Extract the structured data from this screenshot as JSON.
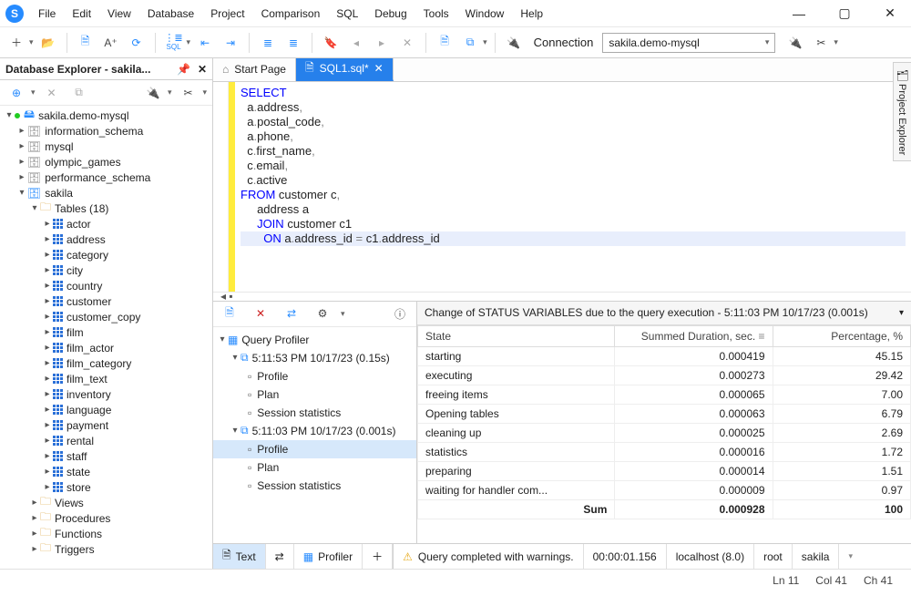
{
  "menubar": [
    "File",
    "Edit",
    "View",
    "Database",
    "Project",
    "Comparison",
    "SQL",
    "Debug",
    "Tools",
    "Window",
    "Help"
  ],
  "connection": {
    "label": "Connection",
    "value": "sakila.demo-mysql"
  },
  "sidebar": {
    "title": "Database Explorer - sakila...",
    "root": "sakila.demo-mysql",
    "schemas": [
      "information_schema",
      "mysql",
      "olympic_games",
      "performance_schema",
      "sakila"
    ],
    "tables_folder": "Tables (18)",
    "tables": [
      "actor",
      "address",
      "category",
      "city",
      "country",
      "customer",
      "customer_copy",
      "film",
      "film_actor",
      "film_category",
      "film_text",
      "inventory",
      "language",
      "payment",
      "rental",
      "staff",
      "state",
      "store"
    ],
    "folders": [
      "Views",
      "Procedures",
      "Functions",
      "Triggers"
    ]
  },
  "tabs": {
    "start": "Start Page",
    "sql": "SQL1.sql*"
  },
  "sql": {
    "l1": "SELECT",
    "l2a": "a",
    "l2b": "address",
    "l3a": "a",
    "l3b": "postal_code",
    "l4a": "a",
    "l4b": "phone",
    "l5a": "c",
    "l5b": "first_name",
    "l6a": "c",
    "l6b": "email",
    "l7a": "c",
    "l7b": "active",
    "l8a": "FROM",
    "l8b": "customer c",
    "l9": "address a",
    "l10a": "JOIN",
    "l10b": "customer c1",
    "l11a": "ON",
    "l11b": "a",
    "l11c": "address_id",
    "l11d": "c1",
    "l11e": "address_id"
  },
  "profiler": {
    "root": "Query Profiler",
    "run1": "5:11:53 PM 10/17/23 (0.15s)",
    "run2": "5:11:03 PM 10/17/23 (0.001s)",
    "items": [
      "Profile",
      "Plan",
      "Session statistics"
    ]
  },
  "results": {
    "header": "Change of STATUS VARIABLES due to the query execution - 5:11:03 PM 10/17/23 (0.001s)",
    "cols": [
      "State",
      "Summed Duration, sec.",
      "Percentage, %"
    ],
    "rows": [
      {
        "s": "starting",
        "d": "0.000419",
        "p": "45.15"
      },
      {
        "s": "executing",
        "d": "0.000273",
        "p": "29.42"
      },
      {
        "s": "freeing items",
        "d": "0.000065",
        "p": "7.00"
      },
      {
        "s": "Opening tables",
        "d": "0.000063",
        "p": "6.79"
      },
      {
        "s": "cleaning up",
        "d": "0.000025",
        "p": "2.69"
      },
      {
        "s": "statistics",
        "d": "0.000016",
        "p": "1.72"
      },
      {
        "s": "preparing",
        "d": "0.000014",
        "p": "1.51"
      },
      {
        "s": "waiting for handler com...",
        "d": "0.000009",
        "p": "0.97"
      }
    ],
    "sum_label": "Sum",
    "sum_d": "0.000928",
    "sum_p": "100"
  },
  "bottom_tabs": {
    "text": "Text",
    "profiler": "Profiler"
  },
  "status": {
    "warn": "Query completed with warnings.",
    "time": "00:00:01.156",
    "host": "localhost (8.0)",
    "user": "root",
    "db": "sakila"
  },
  "cursor": {
    "ln": "Ln 11",
    "col": "Col 41",
    "ch": "Ch 41"
  },
  "project_explorer": "Project Explorer"
}
